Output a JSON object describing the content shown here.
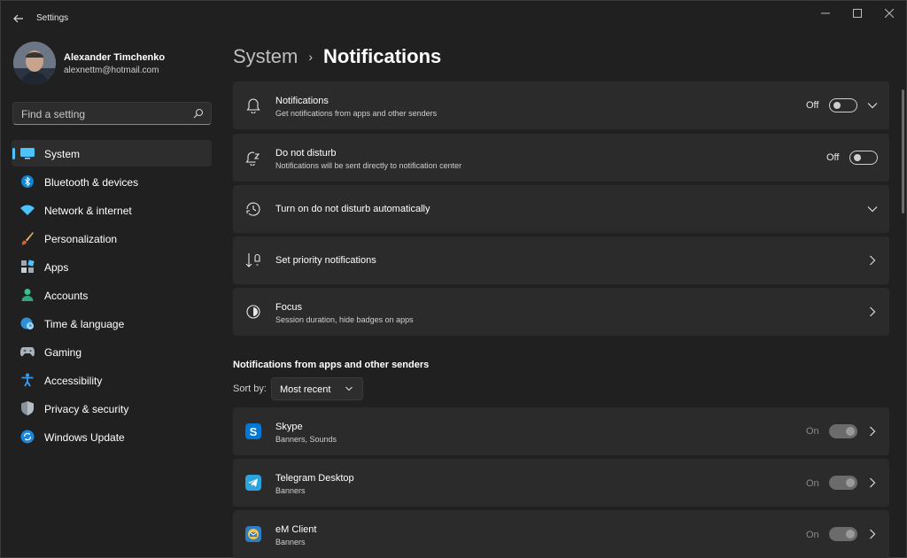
{
  "window": {
    "title": "Settings"
  },
  "profile": {
    "name": "Alexander Timchenko",
    "email": "alexnettm@hotmail.com"
  },
  "search": {
    "placeholder": "Find a setting"
  },
  "nav": [
    {
      "label": "System",
      "icon": "monitor-icon",
      "active": true
    },
    {
      "label": "Bluetooth & devices",
      "icon": "bluetooth-icon"
    },
    {
      "label": "Network & internet",
      "icon": "wifi-icon"
    },
    {
      "label": "Personalization",
      "icon": "brush-icon"
    },
    {
      "label": "Apps",
      "icon": "apps-icon"
    },
    {
      "label": "Accounts",
      "icon": "person-icon"
    },
    {
      "label": "Time & language",
      "icon": "globe-clock-icon"
    },
    {
      "label": "Gaming",
      "icon": "gamepad-icon"
    },
    {
      "label": "Accessibility",
      "icon": "accessibility-icon"
    },
    {
      "label": "Privacy & security",
      "icon": "shield-icon"
    },
    {
      "label": "Windows Update",
      "icon": "update-icon"
    }
  ],
  "breadcrumb": {
    "parent": "System",
    "separator": "›",
    "current": "Notifications"
  },
  "settings": [
    {
      "title": "Notifications",
      "subtitle": "Get notifications from apps and other senders",
      "state": "Off",
      "control": "toggle+expand"
    },
    {
      "title": "Do not disturb",
      "subtitle": "Notifications will be sent directly to notification center",
      "state": "Off",
      "control": "toggle"
    },
    {
      "title": "Turn on do not disturb automatically",
      "subtitle": "",
      "control": "expand"
    },
    {
      "title": "Set priority notifications",
      "subtitle": "",
      "control": "navigate"
    },
    {
      "title": "Focus",
      "subtitle": "Session duration, hide badges on apps",
      "control": "navigate"
    }
  ],
  "apps_section": {
    "title": "Notifications from apps and other senders",
    "sort_label": "Sort by:",
    "sort_value": "Most recent",
    "apps": [
      {
        "name": "Skype",
        "detail": "Banners, Sounds",
        "state": "On",
        "color": "#0078d4"
      },
      {
        "name": "Telegram Desktop",
        "detail": "Banners",
        "state": "On",
        "color": "#2aa3df"
      },
      {
        "name": "eM Client",
        "detail": "Banners",
        "state": "On",
        "color": "#2d7fc1"
      }
    ]
  },
  "colors": {
    "accent": "#4cc2ff",
    "background": "#202020",
    "card": "#2b2b2b"
  }
}
